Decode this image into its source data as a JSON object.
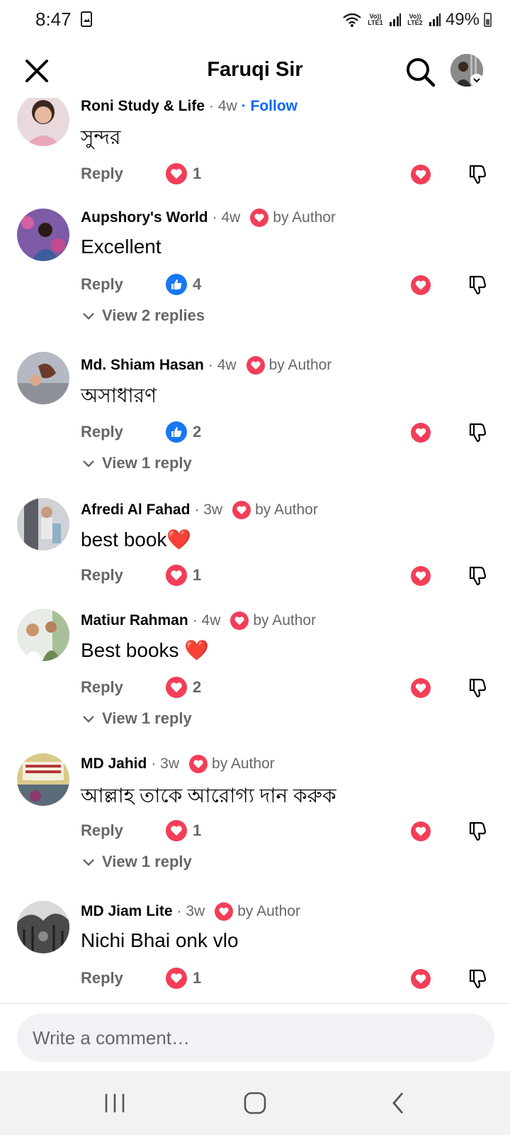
{
  "status_bar": {
    "time": "8:47",
    "battery": "49%",
    "sim1": "Vo)) LTE1",
    "sim2": "Vo)) LTE2"
  },
  "header": {
    "title": "Faruqi Sir"
  },
  "comments": [
    {
      "name": "Roni Study & Life",
      "time": "· 4w",
      "follow": "· Follow",
      "text": "সুন্দর",
      "reply": "Reply",
      "reaction": "love",
      "count": "1"
    },
    {
      "name": "Aupshory's World",
      "time": "· 4w",
      "author_badge": "by Author",
      "text": "Excellent",
      "reply": "Reply",
      "reaction": "like",
      "count": "4",
      "view_replies": "View 2 replies"
    },
    {
      "name": "Md. Shiam Hasan",
      "time": "· 4w",
      "author_badge": "by Author",
      "text": "অসাধারণ",
      "reply": "Reply",
      "reaction": "like",
      "count": "2",
      "view_replies": "View 1 reply"
    },
    {
      "name": "Afredi Al Fahad",
      "time": "· 3w",
      "author_badge": "by Author",
      "text": "best book❤️",
      "reply": "Reply",
      "reaction": "love",
      "count": "1"
    },
    {
      "name": "Matiur Rahman",
      "time": "· 4w",
      "author_badge": "by Author",
      "text": "Best books ❤️",
      "reply": "Reply",
      "reaction": "love",
      "count": "2",
      "view_replies": "View 1 reply"
    },
    {
      "name": "MD Jahid",
      "time": "· 3w",
      "author_badge": "by Author",
      "text": "আল্লাহ তাকে আরোগ্য দান করুক",
      "reply": "Reply",
      "reaction": "love",
      "count": "1",
      "view_replies": "View 1 reply"
    },
    {
      "name": "MD Jiam Lite",
      "time": "· 3w",
      "author_badge": "by Author",
      "text": "Nichi Bhai onk vlo",
      "reply": "Reply",
      "reaction": "love",
      "count": "1"
    }
  ],
  "composer": {
    "placeholder": "Write a comment…"
  },
  "colors": {
    "love": "#f33e58",
    "like": "#1877f2",
    "secondary_text": "#65676b",
    "follow": "#0866ff"
  }
}
